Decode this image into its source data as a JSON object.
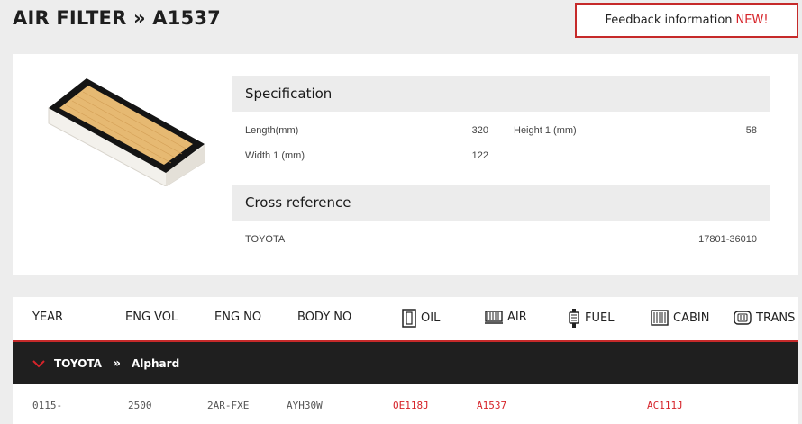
{
  "header": {
    "title": "AIR FILTER » A1537",
    "feedback_label": "Feedback information",
    "feedback_badge": "NEW!"
  },
  "specification": {
    "heading": "Specification",
    "rows": [
      {
        "label": "Length(mm)",
        "value": "320"
      },
      {
        "label": "Height 1 (mm)",
        "value": "58"
      },
      {
        "label": "Width 1 (mm)",
        "value": "122"
      }
    ]
  },
  "cross_reference": {
    "heading": "Cross reference",
    "rows": [
      {
        "brand": "TOYOTA",
        "part": "17801-36010"
      }
    ]
  },
  "vehicle_table": {
    "columns": [
      "YEAR",
      "ENG VOL",
      "ENG NO",
      "BODY NO",
      "OIL",
      "AIR",
      "FUEL",
      "CABIN",
      "TRANS"
    ],
    "column_icons": [
      "oil-filter-icon",
      "air-filter-icon",
      "fuel-filter-icon",
      "cabin-filter-icon",
      "trans-filter-icon"
    ],
    "group": {
      "make": "TOYOTA",
      "separator": "»",
      "model": "Alphard"
    },
    "rows": [
      {
        "year": "0115-",
        "eng_vol": "2500",
        "eng_no": "2AR-FXE",
        "body_no": "AYH30W",
        "oil": "OE118J",
        "air": "A1537",
        "fuel": "",
        "cabin": "AC111J",
        "trans": ""
      }
    ]
  },
  "colors": {
    "accent": "#d6242a",
    "dark": "#1f1f1f",
    "panel": "#ececec"
  }
}
